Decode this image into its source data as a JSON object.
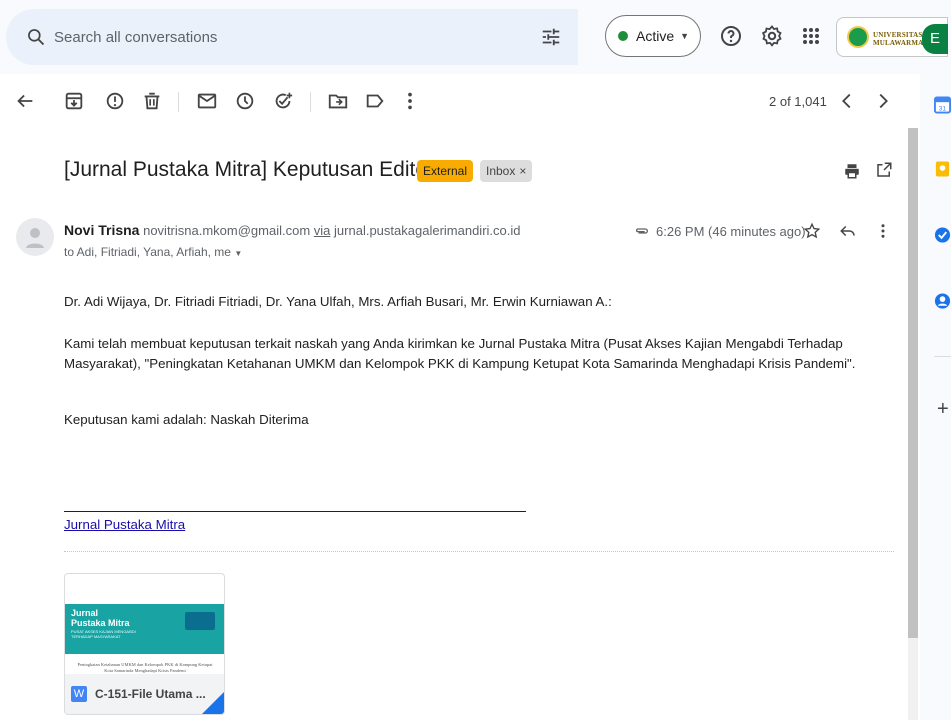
{
  "search": {
    "placeholder": "Search all conversations"
  },
  "status": {
    "label": "Active",
    "color": "#1e8e3e"
  },
  "org": {
    "logo_text": "UNIVERSITAS MULAWARMAN"
  },
  "account": {
    "initial": "E",
    "color": "#0b8043"
  },
  "toolbar": {
    "pager": "2 of 1,041"
  },
  "email": {
    "subject": "[Jurnal Pustaka Mitra] Keputusan Editor",
    "labels": {
      "external": "External",
      "inbox": "Inbox",
      "inbox_remove": "×"
    },
    "sender": {
      "name": "Novi Trisna",
      "email": "novitrisna.mkom@gmail.com",
      "via_label": "via",
      "via_domain": "jurnal.pustakagalerimandiri.co.id"
    },
    "to": "to Adi, Fitriadi, Yana, Arfiah, me",
    "time": "6:26 PM (46 minutes ago)",
    "body": {
      "greeting": "Dr. Adi Wijaya, Dr. Fitriadi Fitriadi, Dr. Yana Ulfah, Mrs. Arfiah Busari, Mr. Erwin Kurniawan A.:",
      "paragraph": "Kami telah membuat keputusan terkait naskah yang Anda kirimkan ke Jurnal Pustaka Mitra (Pusat Akses Kajian Mengabdi Terhadap Masyarakat), \"Peningkatan Ketahanan UMKM dan Kelompok PKK di Kampung Ketupat Kota Samarinda Menghadapi Krisis Pandemi\".",
      "decision": "Keputusan kami adalah: Naskah Diterima"
    },
    "signature_link": "Jurnal Pustaka Mitra",
    "attachment": {
      "thumb_title": "Jurnal Pustaka Mitra",
      "thumb_subtitle": "PUSAT AKSES KAJIAN MENGABDI TERHADAP MASYARAKAT",
      "thumb_body": "Peningkatan Ketahanan UMKM dan Kelompok PKK di Kampung Ketupat Kota Samarinda Menghadapi Krisis Pandemi",
      "type_letter": "W",
      "name": "C-151-File Utama ..."
    }
  }
}
